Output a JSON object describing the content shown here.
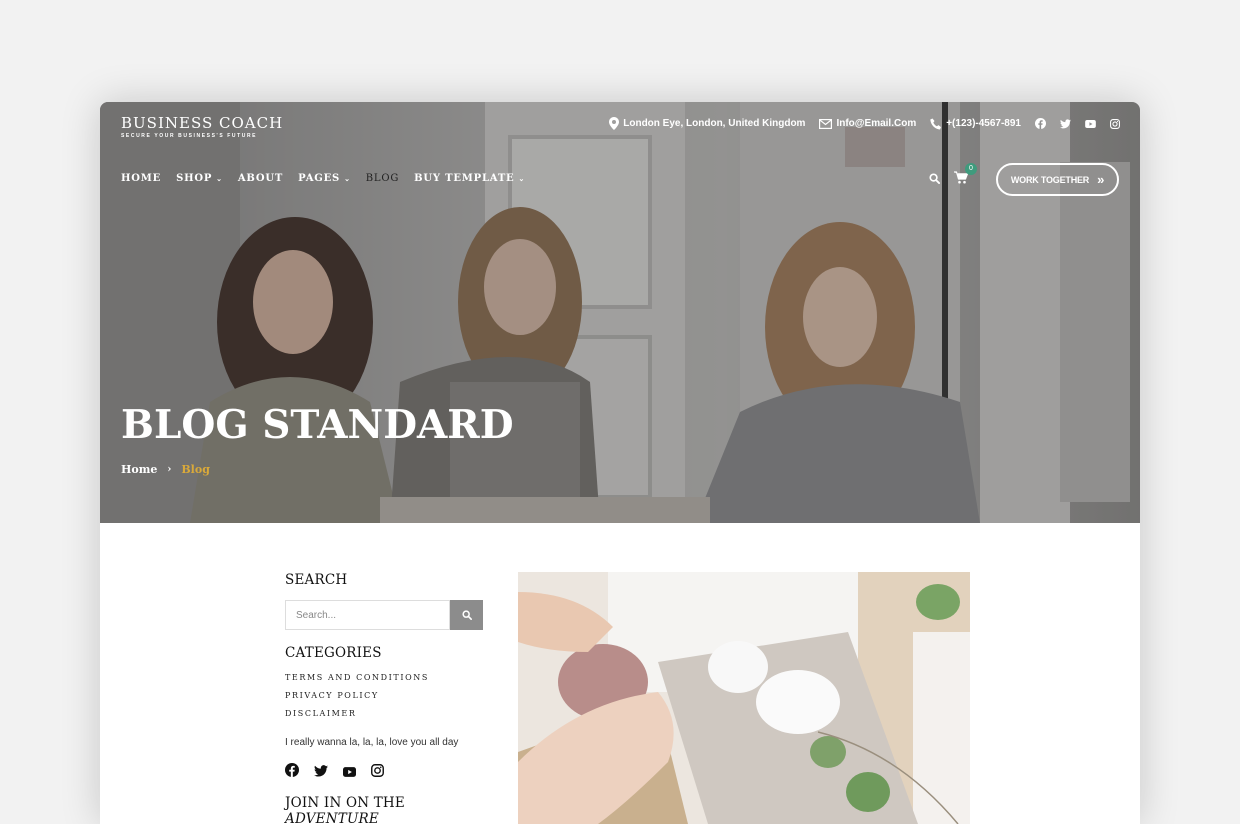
{
  "brand": {
    "name": "BUSINESS COACH",
    "tagline": "SECURE YOUR BUSINESS'S FUTURE"
  },
  "topbar": {
    "address": "London Eye, London, United Kingdom",
    "email": "Info@Email.Com",
    "phone": "+(123)-4567-891",
    "social": [
      "facebook-icon",
      "twitter-icon",
      "youtube-icon",
      "instagram-icon"
    ]
  },
  "nav": {
    "items": [
      {
        "label": "HOME",
        "dropdown": false
      },
      {
        "label": "SHOP",
        "dropdown": true
      },
      {
        "label": "ABOUT",
        "dropdown": false
      },
      {
        "label": "PAGES",
        "dropdown": true
      },
      {
        "label": "BLOG",
        "dropdown": false,
        "active": true
      },
      {
        "label": "BUY TEMPLATE",
        "dropdown": true
      }
    ],
    "cart_count": "0",
    "cta_label": "WORK TOGETHER",
    "cta_icon": "»"
  },
  "hero": {
    "title": "BLOG STANDARD",
    "breadcrumb": {
      "home": "Home",
      "separator": "›",
      "current": "Blog"
    }
  },
  "sidebar": {
    "search_heading": "SEARCH",
    "search_placeholder": "Search...",
    "categories_heading": "CATEGORIES",
    "categories": [
      "TERMS AND CONDITIONS",
      "PRIVACY POLICY",
      "DISCLAIMER"
    ],
    "quote": "I really wanna la, la, la, love you all day",
    "social": [
      "facebook-icon",
      "twitter-icon",
      "youtube-icon",
      "instagram-icon"
    ],
    "adventure_heading": "JOIN IN ON THE",
    "adventure_emphasis": "ADVENTURE"
  },
  "colors": {
    "accent_gold": "#d9a93a",
    "cart_badge": "#3f9b7d",
    "search_button": "#8c8c8c"
  }
}
